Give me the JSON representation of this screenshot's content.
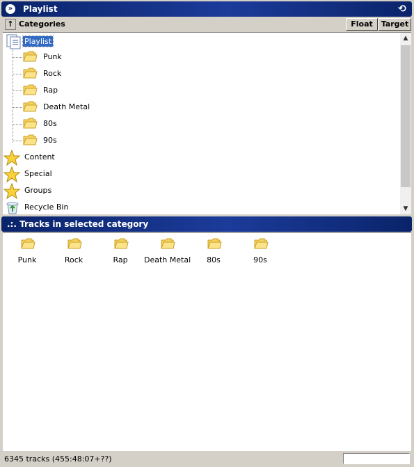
{
  "window": {
    "title": "Playlist"
  },
  "categories_bar": {
    "label": "Categories",
    "float_label": "Float",
    "target_label": "Target"
  },
  "tree": {
    "root": {
      "label": "Playlist",
      "icon": "playlist-document-icon"
    },
    "children": [
      {
        "label": "Punk",
        "icon": "folder-icon"
      },
      {
        "label": "Rock",
        "icon": "folder-icon"
      },
      {
        "label": "Rap",
        "icon": "folder-icon"
      },
      {
        "label": "Death Metal",
        "icon": "folder-icon"
      },
      {
        "label": "80s",
        "icon": "folder-icon"
      },
      {
        "label": "90s",
        "icon": "folder-icon"
      }
    ],
    "top_level": [
      {
        "label": "Content",
        "icon": "star-icon"
      },
      {
        "label": "Special",
        "icon": "star-icon"
      },
      {
        "label": "Groups",
        "icon": "star-icon"
      },
      {
        "label": "Recycle Bin",
        "icon": "recycle-bin-icon"
      }
    ]
  },
  "tracks": {
    "header": ".:. Tracks in selected category",
    "items": [
      {
        "label": "Punk",
        "icon": "folder-icon"
      },
      {
        "label": "Rock",
        "icon": "folder-icon"
      },
      {
        "label": "Rap",
        "icon": "folder-icon"
      },
      {
        "label": "Death Metal",
        "icon": "folder-icon"
      },
      {
        "label": "80s",
        "icon": "folder-icon"
      },
      {
        "label": "90s",
        "icon": "folder-icon"
      }
    ]
  },
  "status": {
    "text": "6345 tracks (455:48:07+??)"
  },
  "colors": {
    "header": "#0a246a",
    "selection": "#316ac5",
    "folder": "#f6d15e",
    "star": "#f9d23b"
  }
}
